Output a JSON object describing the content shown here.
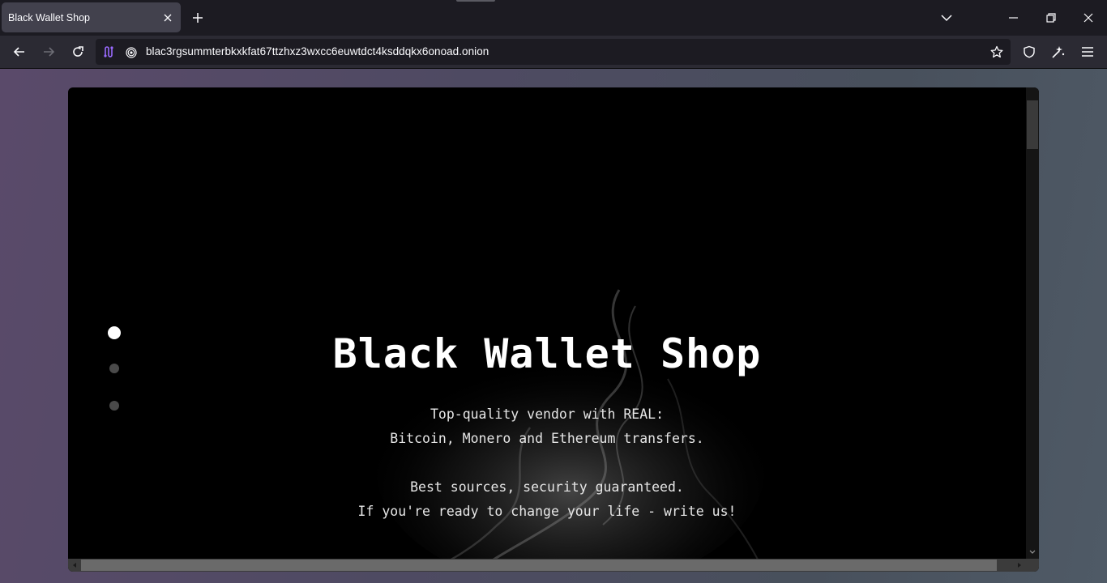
{
  "browser": {
    "tab": {
      "title": "Black Wallet Shop",
      "icons": [
        "close-icon",
        "plus-icon"
      ]
    },
    "window_controls": [
      "chevron-down-icon",
      "minimize-icon",
      "restore-icon",
      "close-icon"
    ],
    "navbar": {
      "url": "blac3rgsummterbkxkfat67ttzhxz3wxcc6euwtdct4ksddqkx6onoad.onion",
      "icons": [
        "back-icon",
        "forward-icon",
        "reload-icon",
        "tor-circuit-icon",
        "onion-icon",
        "bookmark-star-icon",
        "shield-icon",
        "extensions-icon",
        "menu-icon"
      ]
    }
  },
  "page": {
    "title": "Black Wallet Shop",
    "lines": [
      "Top-quality vendor with REAL:",
      "Bitcoin, Monero and Ethereum transfers.",
      "Best sources, security guaranteed.",
      "If you're ready to change your life - write us!"
    ],
    "slide_dots": {
      "count": 3,
      "active_index": 0
    }
  },
  "colors": {
    "chrome_dark": "#1c1b22",
    "toolbar": "#2b2a33",
    "tab_active": "#42414d",
    "page_bg": "#000000",
    "text": "#ffffff"
  }
}
